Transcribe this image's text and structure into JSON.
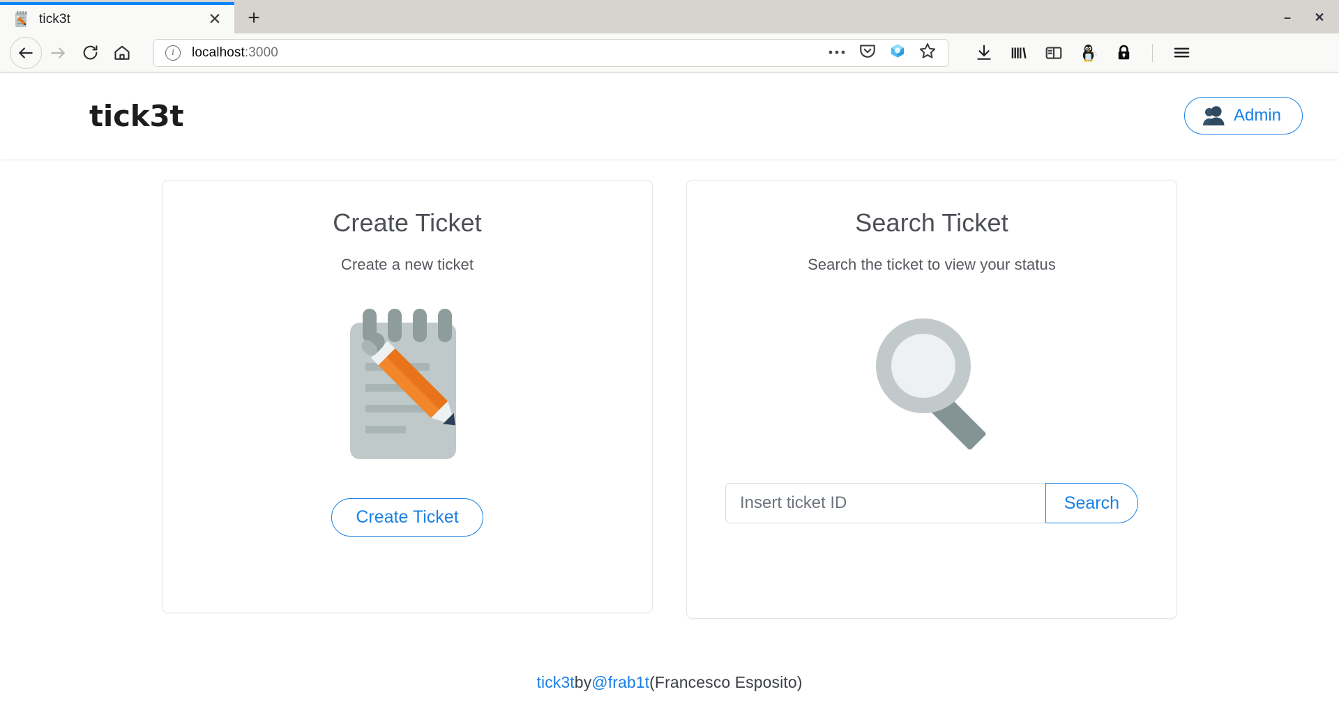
{
  "browser": {
    "tab": {
      "title": "tick3t",
      "favicon_icon": "memo-icon",
      "close_icon": "close-icon"
    },
    "new_tab_icon": "plus-icon",
    "window_controls": {
      "minimize_icon": "minimize-icon",
      "close_icon": "window-close-icon"
    },
    "nav": {
      "back_icon": "back-arrow-icon",
      "forward_icon": "forward-arrow-icon",
      "reload_icon": "reload-icon",
      "home_icon": "home-icon"
    },
    "url": {
      "host": "localhost",
      "port": ":3000",
      "info_icon": "page-info-icon"
    },
    "url_icons": [
      "page-actions-ellipsis-icon",
      "pocket-icon",
      "container-cube-icon",
      "bookmark-star-icon"
    ],
    "toolbar_icons": [
      "downloads-icon",
      "library-icon",
      "sidebar-icon",
      "tux-extension-icon",
      "lock-extension-icon",
      "hamburger-menu-icon"
    ]
  },
  "header": {
    "brand": "tick3t",
    "admin_button": {
      "label": "Admin",
      "icon": "busts-silhouette-icon"
    }
  },
  "cards": [
    {
      "title": "Create Ticket",
      "subtitle": "Create a new ticket",
      "art_icon": "memo-notepad-pencil-icon",
      "button_label": "Create Ticket"
    },
    {
      "title": "Search Ticket",
      "subtitle": "Search the ticket to view your status",
      "art_icon": "magnifying-glass-icon",
      "input_placeholder": "Insert ticket ID",
      "input_value": "",
      "button_label": "Search"
    }
  ],
  "footer": {
    "project_link": "tick3t",
    "by_text": " by ",
    "author_handle": "@frab1t",
    "author_name": " (Francesco Esposito)"
  },
  "colors": {
    "accent_blue": "#1a80e5",
    "tab_active_border": "#0a84ff",
    "text_dark": "#4c4f55",
    "card_border": "#e6e6e6",
    "chrome_bg": "#d7d4d0"
  }
}
